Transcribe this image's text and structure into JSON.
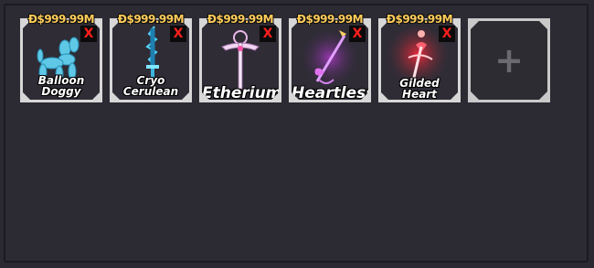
{
  "inventory": {
    "slots": [
      {
        "price": "Ð$999.99M",
        "remove_label": "X",
        "name": "Balloon Doggy",
        "name_line1": "Balloon",
        "name_line2": "Doggy",
        "icon": "balloon-dog-icon"
      },
      {
        "price": "Ð$999.99M",
        "remove_label": "X",
        "name": "Cryo Cerulean",
        "name_line1": "Cryo",
        "name_line2": "Cerulean",
        "icon": "cryo-blade-icon"
      },
      {
        "price": "Ð$999.99M",
        "remove_label": "X",
        "name": "Etherium",
        "icon": "etherium-sword-icon"
      },
      {
        "price": "Ð$999.99M",
        "remove_label": "X",
        "name": "Heartless",
        "icon": "heartless-scythe-icon"
      },
      {
        "price": "Ð$999.99M",
        "remove_label": "X",
        "name": "Gilded Heart",
        "icon": "gilded-heart-sword-icon"
      }
    ],
    "add_label": "+"
  }
}
